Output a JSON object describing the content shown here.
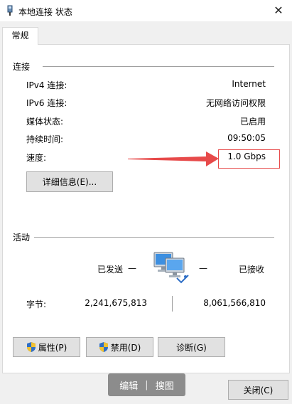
{
  "window": {
    "title": "本地连接 状态",
    "close_glyph": "✕"
  },
  "tabs": [
    {
      "label": "常规"
    }
  ],
  "connection": {
    "title": "连接",
    "rows": [
      {
        "label": "IPv4 连接:",
        "value": "Internet"
      },
      {
        "label": "IPv6 连接:",
        "value": "无网络访问权限"
      },
      {
        "label": "媒体状态:",
        "value": "已启用"
      },
      {
        "label": "持续时间:",
        "value": "09:50:05"
      },
      {
        "label": "速度:",
        "value": "1.0 Gbps"
      }
    ],
    "details_button": "详细信息(E)..."
  },
  "activity": {
    "title": "活动",
    "sent_label": "已发送",
    "received_label": "已接收",
    "bytes_label": "字节:",
    "bytes_sent": "2,241,675,813",
    "bytes_received": "8,061,566,810",
    "dash": "—"
  },
  "actions": {
    "properties": "属性(P)",
    "disable": "禁用(D)",
    "diagnose": "诊断(G)"
  },
  "close_button": "关闭(C)",
  "overlay": {
    "edit": "编辑",
    "separator": "|",
    "search_image": "搜图"
  },
  "colors": {
    "annotation_red": "#e74a4a",
    "shield_blue": "#2f6fc6",
    "shield_yellow": "#f2c230"
  },
  "icons": {
    "window": "network-status-icon",
    "network": "network-computers-icon",
    "shield": "uac-shield-icon"
  }
}
